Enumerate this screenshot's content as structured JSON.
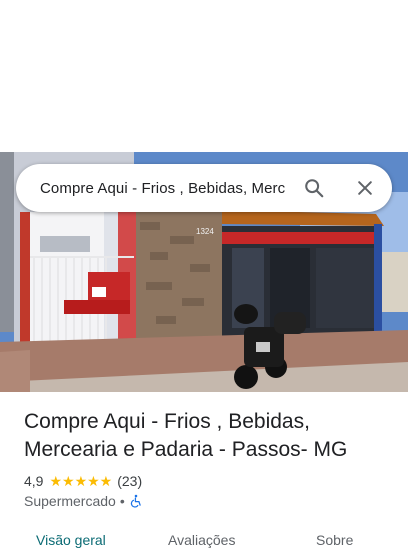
{
  "search": {
    "query": "Compre Aqui - Frios , Bebidas, Merc",
    "search_icon": "search-icon",
    "close_icon": "close-icon"
  },
  "hero": {
    "storefront_number": "1324"
  },
  "place": {
    "name": "Compre Aqui - Frios , Bebidas, Mercearia e Padaria - Passos- MG",
    "rating": "4,9",
    "stars": "★★★★★",
    "review_count": "(23)",
    "category": "Supermercado",
    "separator": "•",
    "accessibility_icon": "wheelchair-icon"
  },
  "tabs": [
    {
      "label": "Visão geral",
      "active": true
    },
    {
      "label": "Avaliações",
      "active": false
    },
    {
      "label": "Sobre",
      "active": false
    }
  ],
  "colors": {
    "star": "#fbbc04",
    "active_tab": "#0b6b74",
    "accessibility": "#1a73e8"
  }
}
